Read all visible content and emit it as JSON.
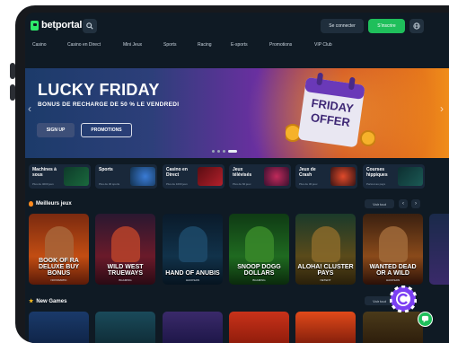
{
  "brand": {
    "name": "betportal"
  },
  "header": {
    "login_label": "Se connecter",
    "signup_label": "S'inscrire"
  },
  "nav": [
    "Casino",
    "Casino en Direct",
    "Mini Jeux",
    "Sports",
    "Racing",
    "E-sports",
    "Promotions",
    "VIP Club"
  ],
  "banner": {
    "title": "LUCKY FRIDAY",
    "subtitle": "BONUS DE RECHARGE DE 50 % LE VENDREDI",
    "btn_primary": "SIGN UP",
    "btn_secondary": "PROMOTIONS",
    "offer_line1": "FRIDAY",
    "offer_line2": "OFFER",
    "slide_count": 4,
    "active_slide": 4
  },
  "categories": [
    {
      "label": "Machines à sous",
      "sub": "Plus de 4000 jeux"
    },
    {
      "label": "Sports",
      "sub": "Plus de 30 sports"
    },
    {
      "label": "Casino en Direct",
      "sub": "Plus de 1000 jeux"
    },
    {
      "label": "Jeux télévisés",
      "sub": "Plus de 60 jeux"
    },
    {
      "label": "Jeux de Crash",
      "sub": "Plus de 30 jeux"
    },
    {
      "label": "Courses hippiques",
      "sub": "Partout au pays"
    }
  ],
  "sections": {
    "best": {
      "title": "Meilleurs jeux",
      "see_all": "Voir tout"
    },
    "new": {
      "title": "New Games",
      "see_all": "Voir tout"
    }
  },
  "games": [
    {
      "name": "BOOK OF RA DELUXE BUY BONUS",
      "provider": "NOVOMATIC"
    },
    {
      "name": "WILD WEST TRUEWAYS",
      "provider": "BGAMING"
    },
    {
      "name": "HAND OF ANUBIS",
      "provider": "HACKSAW"
    },
    {
      "name": "SNOOP DOGG DOLLARS",
      "provider": "BGAMING"
    },
    {
      "name": "ALOHA! CLUSTER PAYS",
      "provider": "NETENT"
    },
    {
      "name": "WANTED DEAD OR A WILD",
      "provider": "HACKSAW"
    }
  ],
  "colors": {
    "accent": "#1fbf5b",
    "bg": "#0f1a24",
    "card": "#19283a"
  }
}
